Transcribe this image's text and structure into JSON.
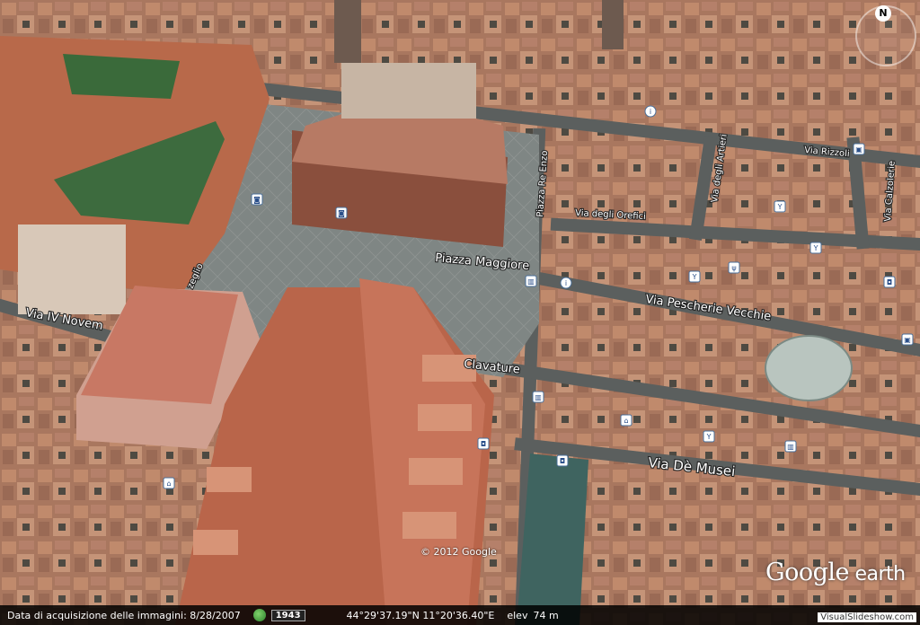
{
  "map": {
    "streets": [
      {
        "id": "piazza-maggiore",
        "text": "Piazza Maggiore"
      },
      {
        "id": "via-pescherie-vecchie",
        "text": "Via Pescherie Vecchie"
      },
      {
        "id": "clavature",
        "text": "Clavature"
      },
      {
        "id": "via-de-musei",
        "text": "Via Dè Musei"
      },
      {
        "id": "via-degli-orefici",
        "text": "Via degli Orefici"
      },
      {
        "id": "via-iv-novembre",
        "text": "Via IV Novem"
      },
      {
        "id": "via-rizzoli",
        "text": "Via Rizzoli"
      },
      {
        "id": "via-degli-artieri",
        "text": "Via degli Artieri"
      },
      {
        "id": "via-calzolerie",
        "text": "Via Calzolerie"
      },
      {
        "id": "piazza-re-enzo",
        "text": "Piazza Re Enzo"
      },
      {
        "id": "zeglio",
        "text": "zeglio"
      }
    ],
    "poi_icon_names": [
      "museum-icon",
      "camera-icon",
      "cocktail-icon",
      "restaurant-icon",
      "shopping-bag-icon",
      "bus-stop-icon",
      "info-icon",
      "hotel-icon"
    ]
  },
  "copyright": "© 2012 Google",
  "logo": {
    "main": "Google",
    "suffix": " earth"
  },
  "compass": {
    "north": "N"
  },
  "status": {
    "acquisition": "Data di acquisizione delle immagini: 8/28/2007",
    "year": "1943",
    "coords": "44°29'37.19\"N 11°20'36.40\"E",
    "elev_label": "elev",
    "elev_value": "74 m"
  },
  "watermark": "VisualSlideshow.com",
  "colors": {
    "roof": "#b2745a",
    "roof_3d": "#c4765a",
    "green_roof": "#3d6b3e",
    "pavement": "#7d8484",
    "status_bg": "#000000"
  }
}
